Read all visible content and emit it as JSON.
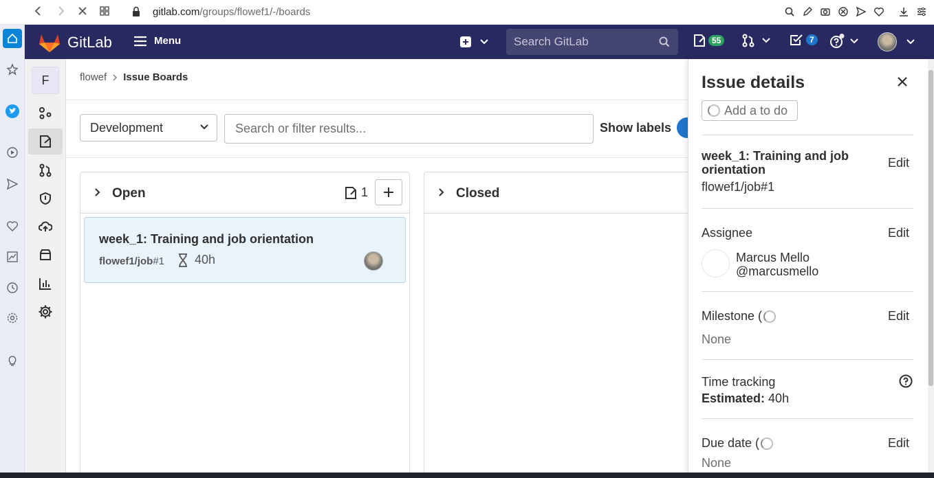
{
  "browser": {
    "url_host": "gitlab.com",
    "url_path": "/groups/flowef1/-/boards"
  },
  "header": {
    "brand": "GitLab",
    "menu_label": "Menu",
    "search_placeholder": "Search GitLab",
    "issues_count": "55",
    "todos_count": "7"
  },
  "sidebar": {
    "group_initial": "F"
  },
  "breadcrumb": {
    "parent": "flowef",
    "current": "Issue Boards"
  },
  "toolbar": {
    "board_name": "Development",
    "filter_placeholder": "Search or filter results...",
    "show_labels": "Show labels"
  },
  "lists": [
    {
      "title": "Open",
      "count": "1"
    },
    {
      "title": "Closed"
    }
  ],
  "card": {
    "title": "week_1: Training and job orientation",
    "ref_path": "flowef1/job",
    "ref_num": "#1",
    "estimate": "40h"
  },
  "drawer": {
    "title": "Issue details",
    "todo_label": "Add a to do",
    "issue_title": "week_1: Training and job orientation",
    "issue_ref": "flowef1/job#1",
    "edit_label": "Edit",
    "assignee_label": "Assignee",
    "assignee_name": "Marcus Mello",
    "assignee_handle": "@marcusmello",
    "milestone_label": "Milestone (",
    "milestone_value": "None",
    "time_label": "Time tracking",
    "estimated_label": "Estimated:",
    "estimated_value": "40h",
    "due_label": "Due date (",
    "due_value": "None"
  },
  "colors": {
    "header_bg": "#292961",
    "accent": "#1f75cb",
    "card_bg": "#e9f3fc",
    "badge_green": "#2da160"
  }
}
